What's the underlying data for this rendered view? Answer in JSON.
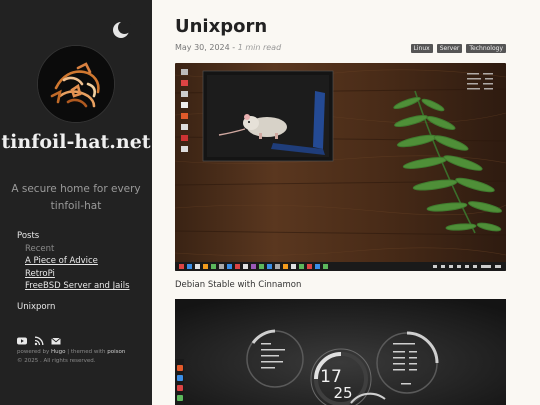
{
  "sidebar": {
    "site_title": "tinfoil-hat.net",
    "description": "A secure home for every tinfoil-hat",
    "nav": {
      "posts_label": "Posts",
      "recent_label": "Recent",
      "recent_items": [
        "A Piece of Advice",
        "RetroPi",
        "FreeBSD Server and Jails"
      ],
      "unixporn_label": "Unixporn"
    },
    "social_icons": [
      "youtube-icon",
      "rss-icon",
      "email-icon"
    ],
    "footer": {
      "powered_prefix": "powered by",
      "powered_engine": "Hugo",
      "separator": "|",
      "themed_prefix": "themed with",
      "theme_name": "poison",
      "copyright": "© 2025 . All rights reserved."
    }
  },
  "post": {
    "title": "Unixporn",
    "date": "May 30, 2024",
    "separator": "-",
    "read_time": "1 min read",
    "tags": [
      "Linux",
      "Server",
      "Technology"
    ],
    "caption": "Debian Stable with Cinnamon"
  },
  "screenshot2": {
    "clock_hour": "17",
    "clock_minute": "25"
  },
  "colors": {
    "sidebar_bg": "#222222",
    "page_bg": "#faf8f3",
    "tag_bg": "#555555"
  }
}
